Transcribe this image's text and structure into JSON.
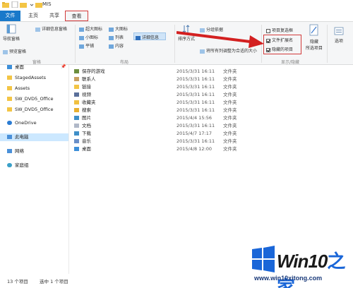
{
  "window": {
    "title": "MIS"
  },
  "tabs": {
    "file": "文件",
    "home": "主页",
    "share": "共享",
    "view": "查看"
  },
  "ribbon": {
    "nav_pane": "导航窗格",
    "preview_pane": "预览窗格",
    "details_pane": "详细信息窗格",
    "pane_group": "窗格",
    "layout": {
      "xl_icons": "超大图标",
      "l_icons": "大图标",
      "m_icons": "中图标",
      "s_icons": "小图标",
      "list": "列表",
      "details": "详细信息",
      "tiles": "平铺",
      "content": "内容",
      "group": "布局"
    },
    "sort_by": "排序方式",
    "group_by": "分组依据",
    "size_all_columns": "将所有列调整为合适的大小",
    "show_hide": {
      "item_checkboxes": "项目复选框",
      "file_extensions": "文件扩展名",
      "hidden_items": "隐藏的项目",
      "item_checkboxes_checked": false,
      "file_extensions_checked": true,
      "hidden_items_checked": true,
      "hide_selected_1": "隐藏",
      "hide_selected_2": "所选项目",
      "group": "显示/隐藏"
    },
    "options": "选项"
  },
  "nav": {
    "quick_items": [
      {
        "label": "桌面",
        "icon": "desktop-icon"
      },
      {
        "label": "StagedAssets",
        "icon": "folder-icon"
      },
      {
        "label": "Assets",
        "icon": "folder-icon"
      },
      {
        "label": "SW_DVD5_Office",
        "icon": "folder-icon"
      },
      {
        "label": "SW_DVD5_Office",
        "icon": "folder-icon"
      }
    ],
    "onedrive": "OneDrive",
    "this_pc": "此电脑",
    "network": "网络",
    "homegroup": "家庭组"
  },
  "files": [
    {
      "name": "保存的游戏",
      "date": "2015/3/31 16:11",
      "type": "文件夹"
    },
    {
      "name": "联系人",
      "date": "2015/3/31 16:11",
      "type": "文件夹"
    },
    {
      "name": "链接",
      "date": "2015/3/31 16:11",
      "type": "文件夹"
    },
    {
      "name": "视频",
      "date": "2015/3/31 16:11",
      "type": "文件夹"
    },
    {
      "name": "收藏夹",
      "date": "2015/3/31 16:11",
      "type": "文件夹"
    },
    {
      "name": "搜索",
      "date": "2015/3/31 16:11",
      "type": "文件夹"
    },
    {
      "name": "图片",
      "date": "2015/4/4 15:56",
      "type": "文件夹"
    },
    {
      "name": "文档",
      "date": "2015/3/31 16:11",
      "type": "文件夹"
    },
    {
      "name": "下载",
      "date": "2015/4/7 17:17",
      "type": "文件夹"
    },
    {
      "name": "音乐",
      "date": "2015/3/31 16:11",
      "type": "文件夹"
    },
    {
      "name": "桌面",
      "date": "2015/4/8 12:00",
      "type": "文件夹"
    }
  ],
  "status": {
    "count": "13 个项目",
    "selected": "选中 1 个项目"
  },
  "watermark": {
    "brand": "Win10",
    "brand_zh": "之家",
    "url": "www.win10xitong.com"
  },
  "colors": {
    "accent": "#1979ca",
    "highlight": "#d23a3a",
    "selection": "#cce8ff"
  }
}
